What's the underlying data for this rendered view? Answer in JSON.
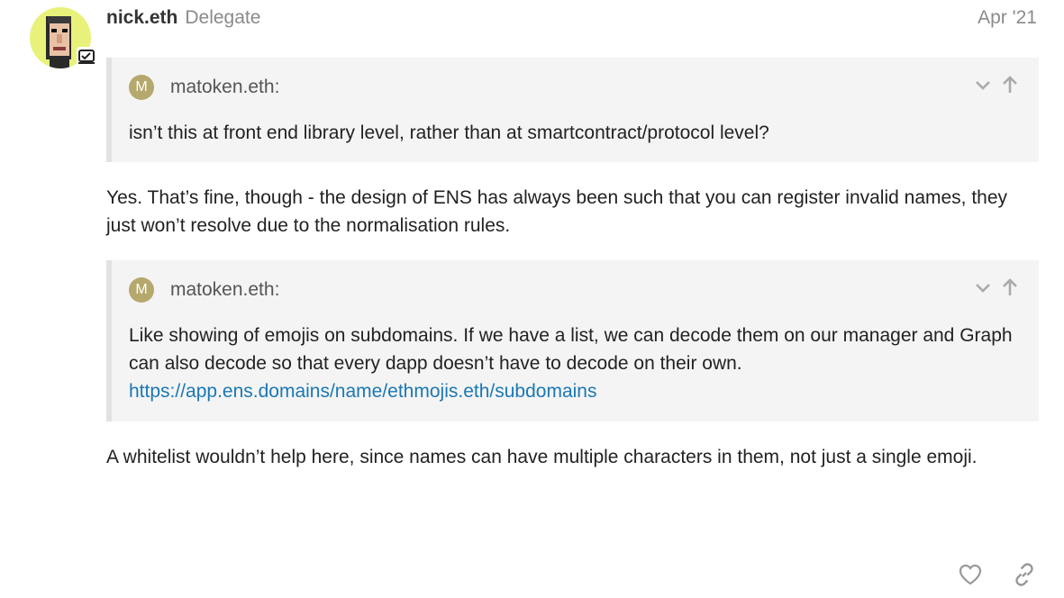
{
  "post": {
    "username": "nick.eth",
    "user_title": "Delegate",
    "date": "Apr '21",
    "avatar_icon": "pixel-avatar",
    "badge_icon": "flair-badge-icon"
  },
  "quote1": {
    "avatar_letter": "M",
    "author": "matoken.eth:",
    "text": "isn’t this at front end library level, rather than at smartcontract/protocol level?",
    "avatar_color": "#b5a86d"
  },
  "paragraph1": "Yes. That’s fine, though - the design of ENS has always been such that you can register invalid names, they just won’t resolve due to the normalisation rules.",
  "quote2": {
    "avatar_letter": "M",
    "author": "matoken.eth:",
    "text": "Like showing of emojis on subdomains. If we have a list, we can decode them on our manager and Graph can also decode so that every dapp doesn’t have to decode on their own.",
    "link": "https://app.ens.domains/name/ethmojis.eth/subdomains"
  },
  "paragraph2": "A whitelist wouldn’t help here, since names can have multiple characters in them, not just a single emoji.",
  "colors": {
    "link": "#1a78b5",
    "quote_bg": "#f4f4f4",
    "quote_border": "#e2e2e2",
    "avatar_bg": "#e8f27a",
    "muted": "#8a8a8a"
  },
  "icons": [
    "chevron-down-icon",
    "arrow-up-icon",
    "heart-icon",
    "link-icon"
  ]
}
